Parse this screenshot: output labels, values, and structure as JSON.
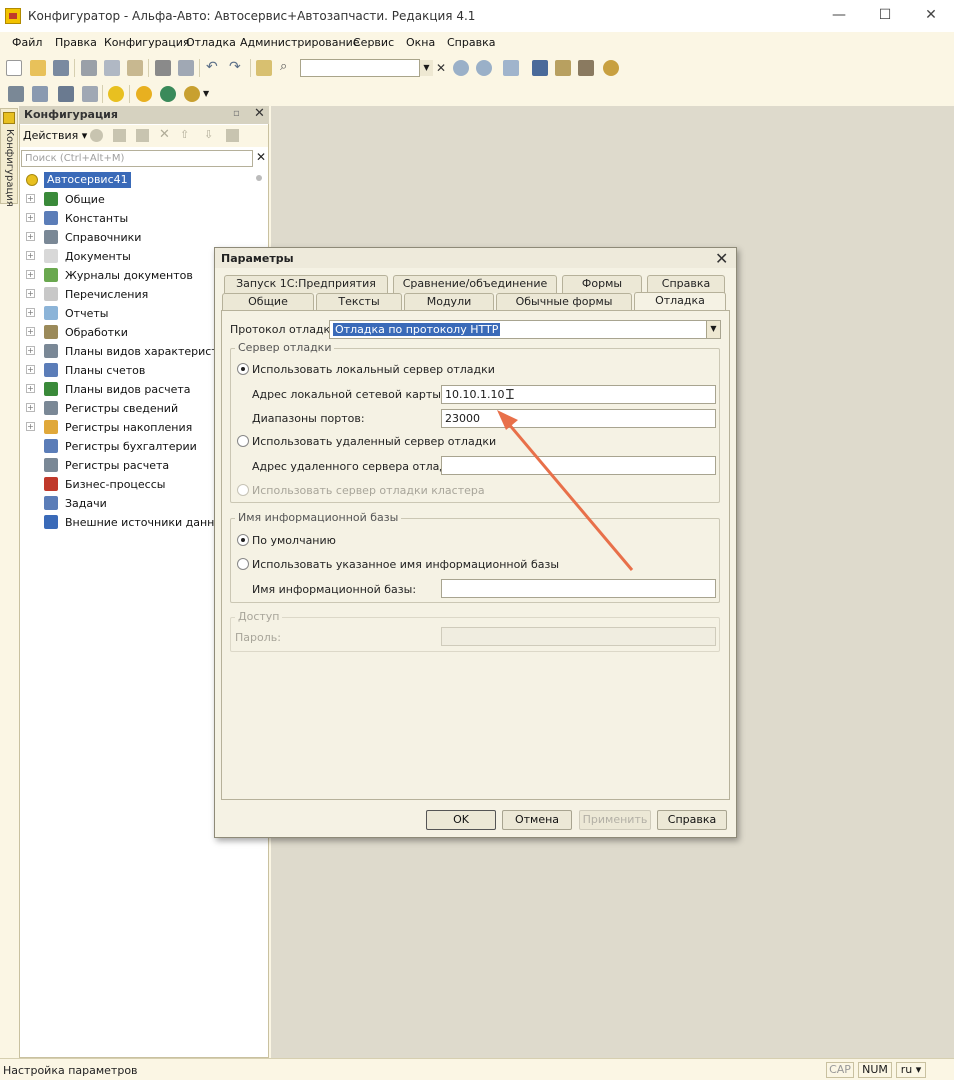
{
  "window": {
    "title": "Конфигуратор - Альфа-Авто: Автосервис+Автозапчасти. Редакция 4.1",
    "minimize": "—",
    "maximize": "☐",
    "close": "✕"
  },
  "menu": [
    "Файл",
    "Правка",
    "Конфигурация",
    "Отладка",
    "Администрирование",
    "Сервис",
    "Окна",
    "Справка"
  ],
  "left_tab": "Конфигурация",
  "config_panel": {
    "title": "Конфигурация",
    "actions": "Действия",
    "search_placeholder": "Поиск (Ctrl+Alt+M)",
    "root": "Автосервис41",
    "items": [
      {
        "label": "Общие",
        "color": "#3a8a3a"
      },
      {
        "label": "Константы",
        "color": "#5b7db8"
      },
      {
        "label": "Справочники",
        "color": "#7a8896"
      },
      {
        "label": "Документы",
        "color": "#d8d8d8"
      },
      {
        "label": "Журналы документов",
        "color": "#6aa84f"
      },
      {
        "label": "Перечисления",
        "color": "#c8c8c8"
      },
      {
        "label": "Отчеты",
        "color": "#8cb4d8"
      },
      {
        "label": "Обработки",
        "color": "#9b8a5a"
      },
      {
        "label": "Планы видов характеристик",
        "color": "#7a8896"
      },
      {
        "label": "Планы счетов",
        "color": "#5b7db8"
      },
      {
        "label": "Планы видов расчета",
        "color": "#3a8a3a"
      },
      {
        "label": "Регистры сведений",
        "color": "#7a8896"
      },
      {
        "label": "Регистры накопления",
        "color": "#e0a83a"
      },
      {
        "label": "Регистры бухгалтерии",
        "color": "#5b7db8"
      },
      {
        "label": "Регистры расчета",
        "color": "#7a8896"
      },
      {
        "label": "Бизнес-процессы",
        "color": "#c0392b"
      },
      {
        "label": "Задачи",
        "color": "#5b7db8"
      },
      {
        "label": "Внешние источники данных",
        "color": "#3a6ab8"
      }
    ]
  },
  "dialog": {
    "title": "Параметры",
    "tabs_row1": [
      "Запуск 1С:Предприятия",
      "Сравнение/объединение",
      "Формы",
      "Справка"
    ],
    "tabs_row2": [
      "Общие",
      "Тексты",
      "Модули",
      "Обычные формы",
      "Отладка"
    ],
    "protocol_label": "Протокол отладки:",
    "protocol_value": "Отладка по протоколу HTTP",
    "debug_server_group": "Сервер отладки",
    "use_local": "Использовать локальный сервер отладки",
    "local_nic_label": "Адрес локальной сетевой карты:",
    "local_nic_value": "10.10.1.10",
    "ports_label": "Диапазоны портов:",
    "ports_value": "23000",
    "use_remote": "Использовать удаленный сервер отладки",
    "remote_addr_label": "Адрес удаленного сервера отладки:",
    "remote_addr_value": "",
    "use_cluster": "Использовать сервер отладки кластера",
    "ib_group": "Имя информационной базы",
    "ib_default": "По умолчанию",
    "ib_custom": "Использовать указанное имя информационной базы",
    "ib_name_label": "Имя информационной базы:",
    "ib_name_value": "",
    "access_group": "Доступ",
    "password_label": "Пароль:",
    "ok": "OK",
    "cancel": "Отмена",
    "apply": "Применить",
    "help": "Справка"
  },
  "statusbar": {
    "text": "Настройка параметров",
    "cap": "CAP",
    "num": "NUM",
    "lang": "ru ▾"
  },
  "colors": {
    "app_bg": "#fbf6e4",
    "work_area": "#dedacc",
    "selection": "#3a6ab8",
    "annotation_arrow": "#e8704a"
  }
}
